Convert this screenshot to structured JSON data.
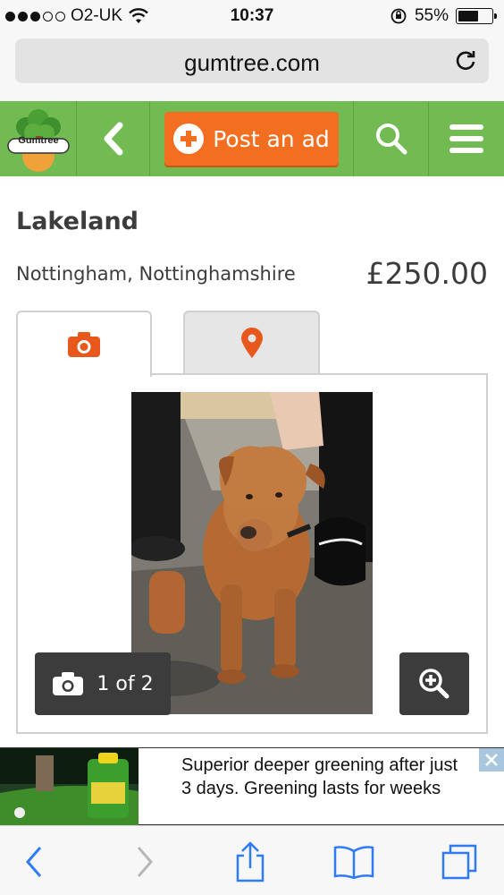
{
  "status_bar": {
    "carrier": "O2-UK",
    "time": "10:37",
    "battery_percent": "55%",
    "battery_level": 0.55,
    "signal_bars": 3
  },
  "browser": {
    "url": "gumtree.com"
  },
  "header": {
    "logo_text": "Gumtree",
    "post_label": "Post an ad",
    "colors": {
      "brand_green": "#72bb53",
      "post_orange": "#f26f21"
    }
  },
  "listing": {
    "title": "Lakeland",
    "location": "Nottingham, Nottinghamshire",
    "price": "£250.00",
    "photo_counter": "1 of 2"
  },
  "tabs": [
    {
      "icon": "camera-icon",
      "active": true
    },
    {
      "icon": "map-pin-icon",
      "active": false
    }
  ],
  "ad": {
    "text": "Superior deeper greening after just 3 days. Greening lasts for weeks"
  },
  "toolbar": {
    "items": [
      "back-arrow-icon",
      "forward-arrow-icon",
      "share-icon",
      "bookmarks-icon",
      "tabs-icon"
    ]
  }
}
